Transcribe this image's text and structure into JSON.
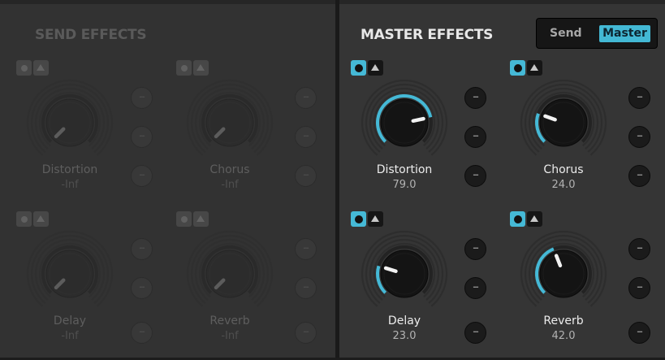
{
  "send_effects": {
    "title": "SEND EFFECTS",
    "effects": [
      {
        "name": "Distortion",
        "value": "-Inf",
        "level": 0
      },
      {
        "name": "Chorus",
        "value": "-Inf",
        "level": 0
      },
      {
        "name": "Delay",
        "value": "-Inf",
        "level": 0
      },
      {
        "name": "Reverb",
        "value": "-Inf",
        "level": 0
      }
    ]
  },
  "master_effects": {
    "title": "MASTER EFFECTS",
    "mode_toggle": {
      "send_label": "Send",
      "master_label": "Master",
      "selected": "Master"
    },
    "effects": [
      {
        "name": "Distortion",
        "value": "79.0",
        "level": 79
      },
      {
        "name": "Chorus",
        "value": "24.0",
        "level": 24
      },
      {
        "name": "Delay",
        "value": "23.0",
        "level": 23
      },
      {
        "name": "Reverb",
        "value": "42.0",
        "level": 42
      }
    ]
  },
  "icons": {
    "power": "power-icon",
    "edit": "arrow-up-icon",
    "side_button": "dash-icon"
  },
  "side_button_glyph": "--",
  "colors": {
    "accent": "#45b9d6",
    "panel_bg": "#353535",
    "disabled_text": "#5e5e5e"
  }
}
